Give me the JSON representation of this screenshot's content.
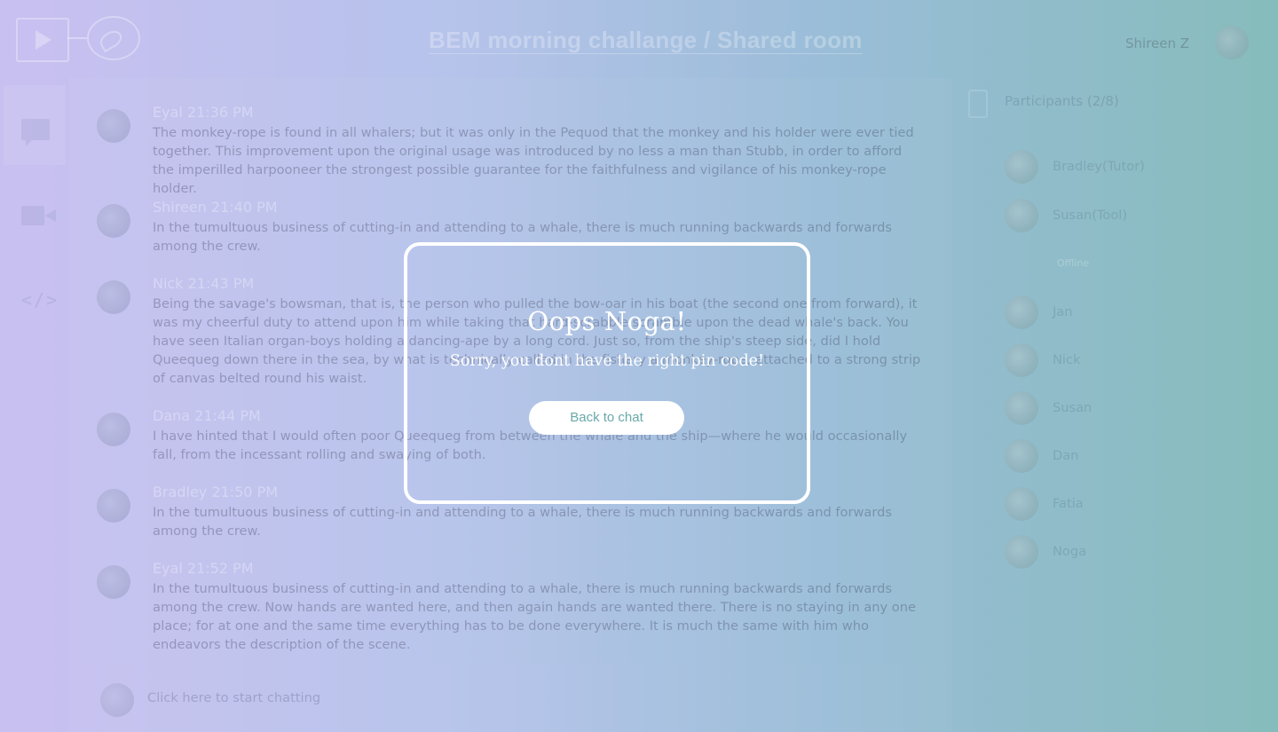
{
  "header": {
    "room_title": "BEM morning challange / Shared room",
    "user_name": "Shireen Z"
  },
  "sidebar": {
    "items": [
      {
        "name": "chat",
        "icon": "chat-bubble-icon"
      },
      {
        "name": "video",
        "icon": "video-camera-icon"
      },
      {
        "name": "code",
        "icon": "code-icon",
        "glyph": "</>"
      }
    ]
  },
  "messages": [
    {
      "author": "Eyal",
      "time": "21:36 PM",
      "text": "The monkey-rope is found in all whalers; but it was only in the Pequod that the monkey and his holder were ever tied together. This improvement upon the original usage was introduced by no less a man than Stubb, in order to afford the imperilled harpooneer the strongest possible guarantee for the faithfulness and vigilance of his monkey-rope holder."
    },
    {
      "author": "Shireen",
      "time": "21:40 PM",
      "text": "In the tumultuous business of cutting-in and attending to a whale, there is much running backwards and forwards among the crew."
    },
    {
      "author": "Nick",
      "time": "21:43 PM",
      "text": "Being the savage's bowsman, that is, the person who pulled the bow-oar in his boat (the second one from forward), it was my cheerful duty to attend upon him while taking that hard-scrabble scramble upon the dead whale's back. You have seen Italian organ-boys holding a dancing-ape by a long cord. Just so, from the ship's steep side, did I hold Queequeg down there in the sea, by what is technically called in the fishery a monkey-rope, attached to a strong strip of canvas belted round his waist."
    },
    {
      "author": "Dana",
      "time": "21:44 PM",
      "text": "I have hinted that I would often poor Queequeg from between the whale and the ship—where he would occasionally fall, from the incessant rolling and swaying of both."
    },
    {
      "author": "Bradley",
      "time": "21:50 PM",
      "text": "In the tumultuous business of cutting-in and attending to a whale, there is much running backwards and forwards among the crew."
    },
    {
      "author": "Eyal",
      "time": "21:52 PM",
      "text": "In the tumultuous business of cutting-in and attending to a whale, there is much running backwards and forwards among the crew. Now hands are wanted here, and then again hands are wanted there. There is no staying in any one place; for at one and the same time everything has to be done everywhere. It is much the same with him who endeavors the description of the scene."
    }
  ],
  "composer": {
    "placeholder": "Click here to start chatting"
  },
  "participants": {
    "title": "Participants (2/8)",
    "online": [
      "Bradley(Tutor)",
      "Susan(Tool)"
    ],
    "divider": "Offline",
    "offline": [
      "Jan",
      "Nick",
      "Susan",
      "Dan",
      "Fatia",
      "Noga"
    ]
  },
  "modal": {
    "title": "Oops Noga!",
    "message": "Sorry, you dont have the right pin code!",
    "button_label": "Back to chat"
  }
}
